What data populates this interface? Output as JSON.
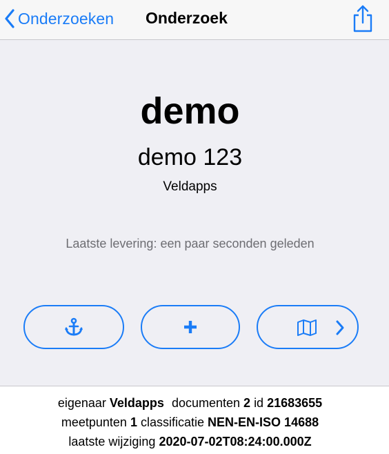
{
  "navbar": {
    "back_label": "Onderzoeken",
    "title": "Onderzoek",
    "back_icon": "chevron-left-icon",
    "share_icon": "share-icon"
  },
  "project": {
    "name": "demo",
    "code": "demo 123",
    "owner": "Veldapps",
    "last_delivery": "Laatste levering: een paar seconden geleden"
  },
  "actions": [
    {
      "icon": "anchor-icon"
    },
    {
      "icon": "plus-icon"
    },
    {
      "icon": "map-icon",
      "secondary_icon": "chevron-right-icon"
    }
  ],
  "info": {
    "owner_label": "eigenaar",
    "owner_value": "Veldapps",
    "documents_label": "documenten",
    "documents_value": "2",
    "id_label": "id",
    "id_value": "21683655",
    "measurepoints_label": "meetpunten",
    "measurepoints_value": "1",
    "classification_label": "classificatie",
    "classification_value": "NEN-EN-ISO 14688",
    "last_modified_label": "laatste wijziging",
    "last_modified_value": "2020-07-02T08:24:00.000Z"
  },
  "colors": {
    "accent": "#1a7cf7",
    "panel_background": "#efeff4",
    "navbar_background": "#f7f7f7",
    "muted_text": "#6d6d72"
  }
}
